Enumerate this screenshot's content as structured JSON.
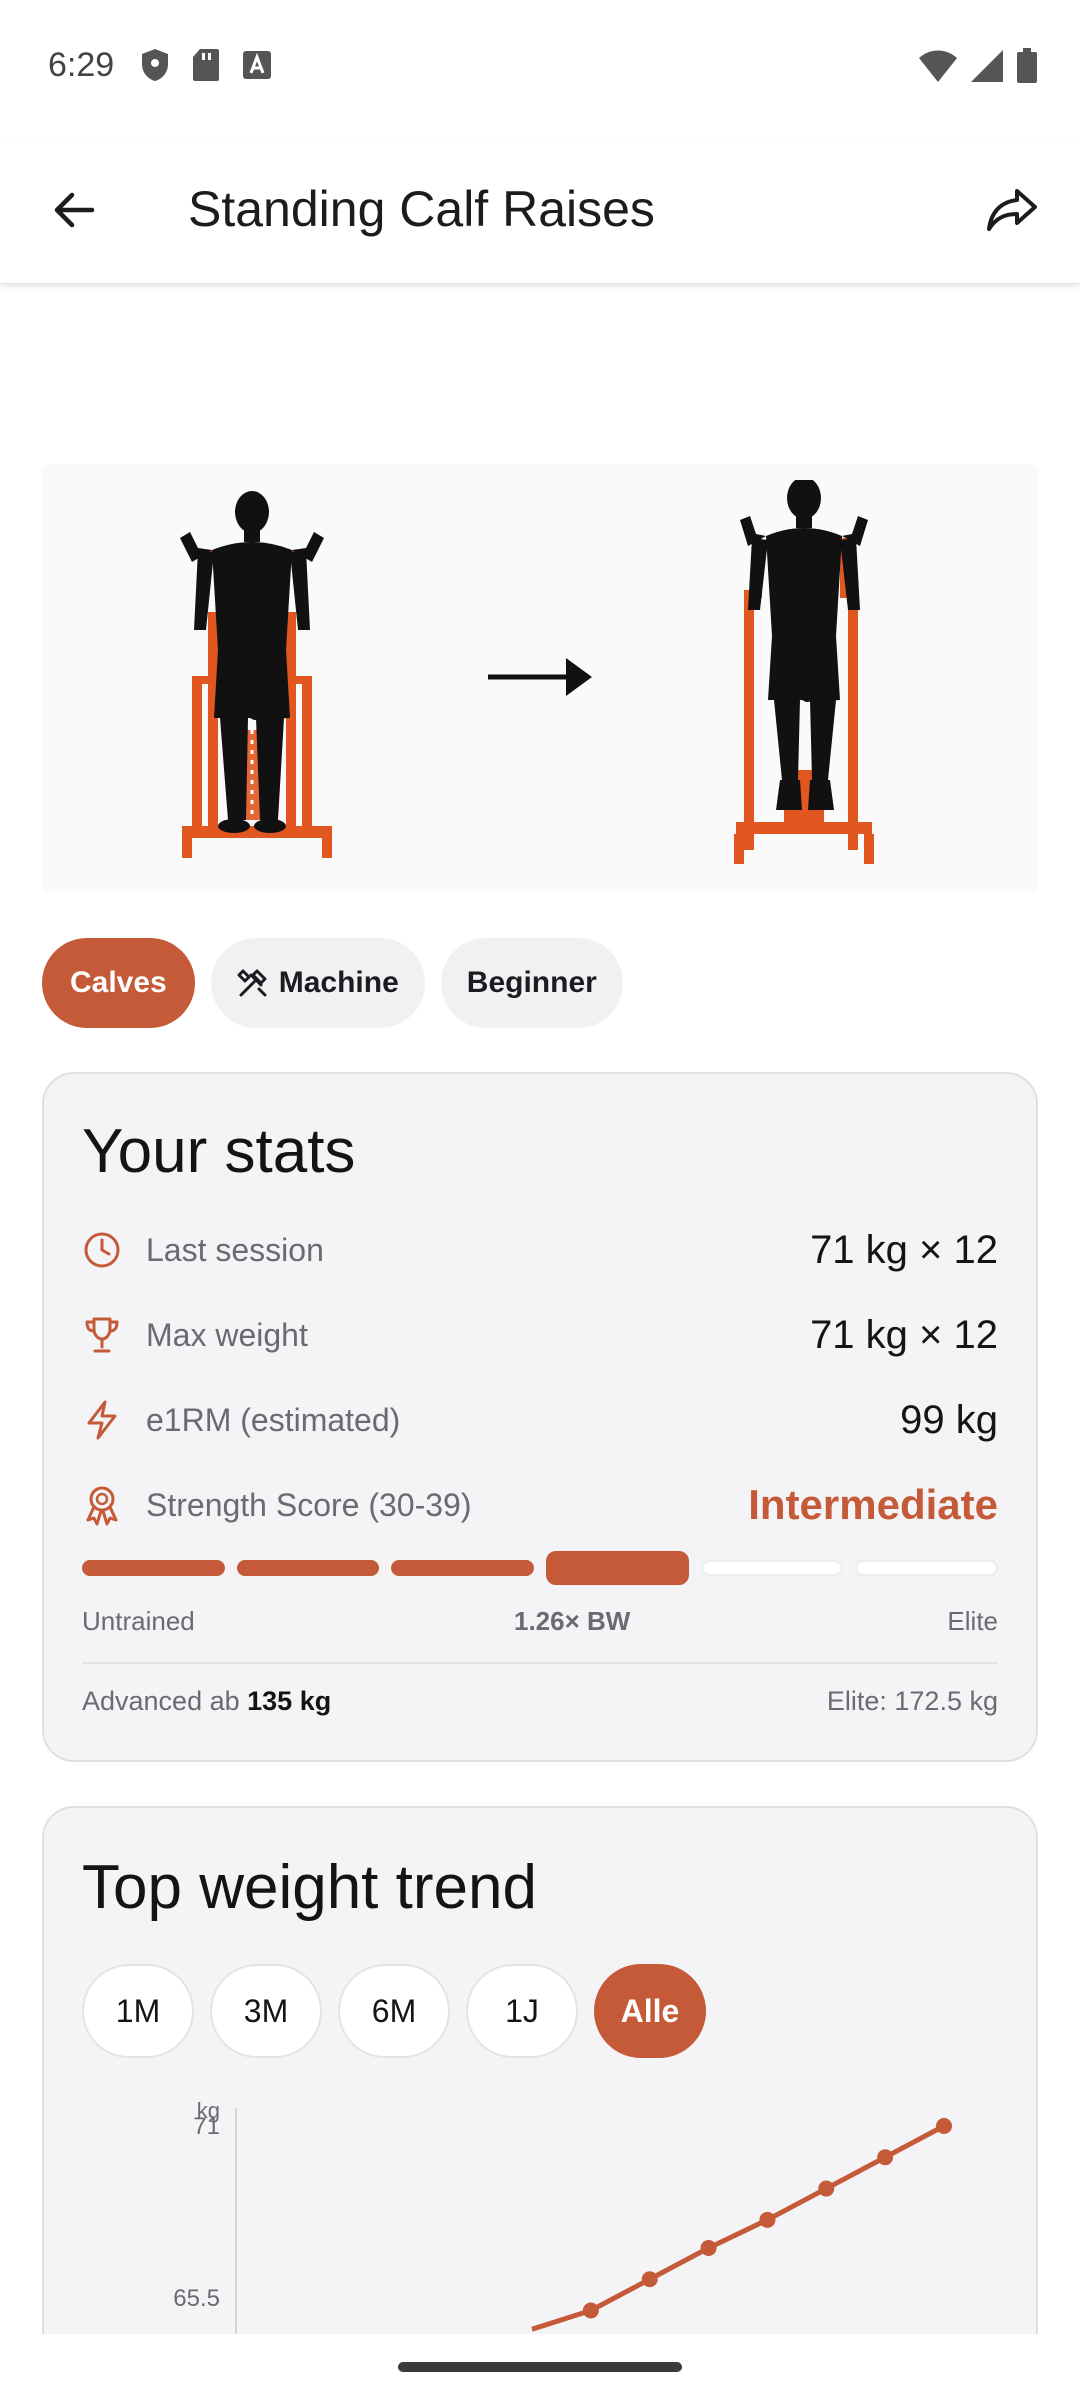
{
  "status_bar": {
    "time": "6:29",
    "left_icons": [
      "shield-icon",
      "sd-card-icon",
      "text-a-icon"
    ],
    "right_icons": [
      "wifi-icon",
      "cellular-icon",
      "battery-icon"
    ]
  },
  "app_bar": {
    "title": "Standing Calf Raises",
    "back_icon": "arrow-back-icon",
    "share_icon": "share-icon"
  },
  "hero": {
    "arrow_icon": "arrow-right-icon"
  },
  "chips": {
    "muscle": "Calves",
    "equipment": "Machine",
    "equipment_icon": "tools-icon",
    "level": "Beginner"
  },
  "stats": {
    "title": "Your stats",
    "rows": [
      {
        "icon": "clock-icon",
        "label": "Last session",
        "value": "71 kg × 12"
      },
      {
        "icon": "trophy-icon",
        "label": "Max weight",
        "value": "71 kg × 12"
      },
      {
        "icon": "bolt-icon",
        "label": "e1RM (estimated)",
        "value": "99 kg"
      },
      {
        "icon": "award-icon",
        "label": "Strength Score (30-39)",
        "value": "Intermediate"
      }
    ],
    "levels_total": 6,
    "level_current": 4,
    "scale_left": "Untrained",
    "scale_mid": "1.26× BW",
    "scale_right": "Elite",
    "next_prefix": "Advanced ab",
    "next_value": "135 kg",
    "elite_text": "Elite: 172.5 kg",
    "accent_color": "#c45a38"
  },
  "trend": {
    "title": "Top weight trend",
    "ranges": [
      "1M",
      "3M",
      "6M",
      "1J",
      "Alle"
    ],
    "active_range": "Alle"
  },
  "chart_data": {
    "type": "line",
    "ylabel": "kg",
    "yticks": [
      65.5,
      71
    ],
    "ylim": [
      60,
      71
    ],
    "x": [
      1,
      2,
      3,
      4,
      5,
      6,
      7,
      8
    ],
    "series": [
      {
        "values": [
          64.5,
          65.1,
          66.1,
          67.1,
          68.0,
          69.0,
          70.0,
          71.0
        ]
      }
    ],
    "grid": false
  }
}
